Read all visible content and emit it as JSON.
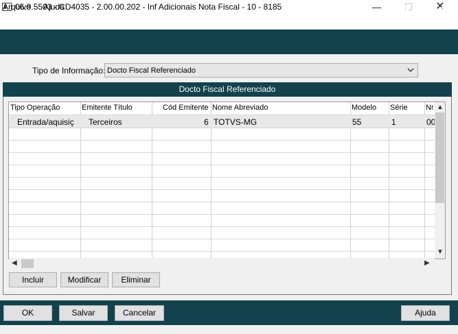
{
  "window": {
    "title": "06.9.5503 - CD4035 - 2.00.00.202 - Inf Adicionais Nota Fiscal - 10 - 8185",
    "min_glyph": "—",
    "max_glyph": "☐",
    "close_glyph": "✕"
  },
  "menu": {
    "items": [
      "Arquivo",
      "Ajuda"
    ]
  },
  "toolbar": {
    "icons": [
      "structure-icon",
      "print-icon",
      "exit-icon",
      "help-icon"
    ],
    "bg_color": "#13424f"
  },
  "form": {
    "tipo_label": "Tipo de Informação:",
    "tipo_value": "Docto Fiscal Referenciado"
  },
  "group": {
    "title": "Docto Fiscal Referenciado",
    "columns": [
      "Tipo Operação",
      "Emitente Título",
      "Cód Emitente",
      "Nome Abreviado",
      "Modelo",
      "Série",
      "Nr"
    ],
    "rows": [
      [
        "Entrada/aquisiç",
        "Terceiros",
        "6",
        "TOTVS-MG",
        "55",
        "1",
        "00"
      ]
    ],
    "buttons": {
      "incluir": "Incluir",
      "modificar": "Modificar",
      "eliminar": "Eliminar"
    }
  },
  "footer": {
    "ok": "OK",
    "salvar": "Salvar",
    "cancelar": "Cancelar",
    "ajuda": "Ajuda"
  }
}
